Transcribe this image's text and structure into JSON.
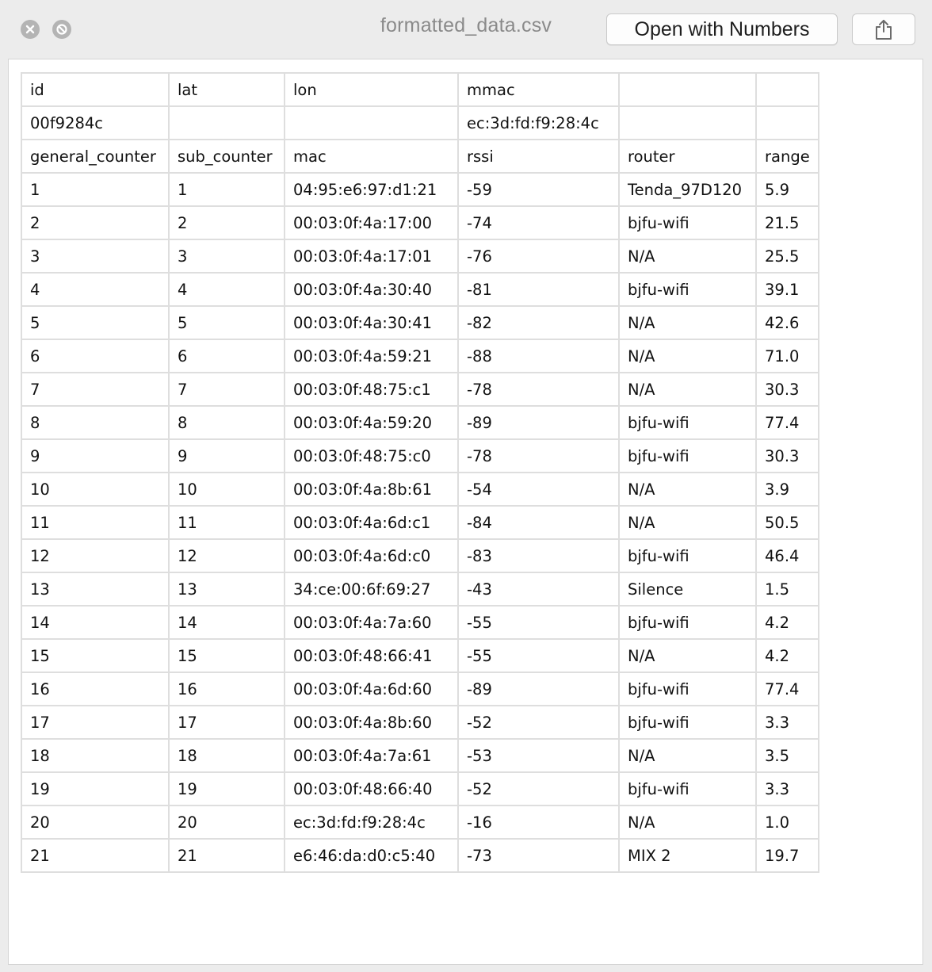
{
  "window": {
    "title": "formatted_data.csv",
    "open_button_label": "Open with Numbers",
    "icons": {
      "close": "close-icon",
      "minimize": "minimize-icon",
      "share": "share-icon"
    }
  },
  "table": {
    "rows": [
      [
        "id",
        "lat",
        "lon",
        "mmac",
        "",
        ""
      ],
      [
        "00f9284c",
        "",
        "",
        "ec:3d:fd:f9:28:4c",
        "",
        ""
      ],
      [
        "general_counter",
        "sub_counter",
        "mac",
        "rssi",
        "router",
        "range"
      ],
      [
        "1",
        "1",
        "04:95:e6:97:d1:21",
        "-59",
        "Tenda_97D120",
        "5.9"
      ],
      [
        "2",
        "2",
        "00:03:0f:4a:17:00",
        "-74",
        "bjfu-wifi",
        "21.5"
      ],
      [
        "3",
        "3",
        "00:03:0f:4a:17:01",
        "-76",
        "N/A",
        "25.5"
      ],
      [
        "4",
        "4",
        "00:03:0f:4a:30:40",
        "-81",
        "bjfu-wifi",
        "39.1"
      ],
      [
        "5",
        "5",
        "00:03:0f:4a:30:41",
        "-82",
        "N/A",
        "42.6"
      ],
      [
        "6",
        "6",
        "00:03:0f:4a:59:21",
        "-88",
        "N/A",
        "71.0"
      ],
      [
        "7",
        "7",
        "00:03:0f:48:75:c1",
        "-78",
        "N/A",
        "30.3"
      ],
      [
        "8",
        "8",
        "00:03:0f:4a:59:20",
        "-89",
        "bjfu-wifi",
        "77.4"
      ],
      [
        "9",
        "9",
        "00:03:0f:48:75:c0",
        "-78",
        "bjfu-wifi",
        "30.3"
      ],
      [
        "10",
        "10",
        "00:03:0f:4a:8b:61",
        "-54",
        "N/A",
        "3.9"
      ],
      [
        "11",
        "11",
        "00:03:0f:4a:6d:c1",
        "-84",
        "N/A",
        "50.5"
      ],
      [
        "12",
        "12",
        "00:03:0f:4a:6d:c0",
        "-83",
        "bjfu-wifi",
        "46.4"
      ],
      [
        "13",
        "13",
        "34:ce:00:6f:69:27",
        "-43",
        "Silence",
        "1.5"
      ],
      [
        "14",
        "14",
        "00:03:0f:4a:7a:60",
        "-55",
        "bjfu-wifi",
        "4.2"
      ],
      [
        "15",
        "15",
        "00:03:0f:48:66:41",
        "-55",
        "N/A",
        "4.2"
      ],
      [
        "16",
        "16",
        "00:03:0f:4a:6d:60",
        "-89",
        "bjfu-wifi",
        "77.4"
      ],
      [
        "17",
        "17",
        "00:03:0f:4a:8b:60",
        "-52",
        "bjfu-wifi",
        "3.3"
      ],
      [
        "18",
        "18",
        "00:03:0f:4a:7a:61",
        "-53",
        "N/A",
        "3.5"
      ],
      [
        "19",
        "19",
        "00:03:0f:48:66:40",
        "-52",
        "bjfu-wifi",
        "3.3"
      ],
      [
        "20",
        "20",
        "ec:3d:fd:f9:28:4c",
        "-16",
        "N/A",
        "1.0"
      ],
      [
        "21",
        "21",
        "e6:46:da:d0:c5:40",
        "-73",
        "MIX 2",
        "19.7"
      ]
    ]
  }
}
